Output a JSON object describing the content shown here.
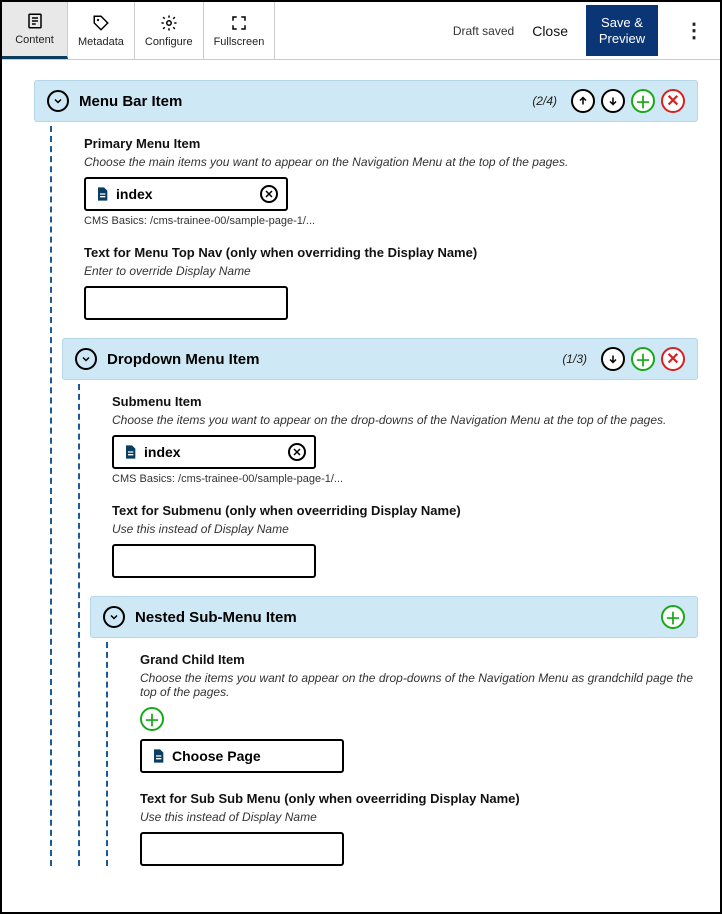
{
  "toolbar": {
    "tabs": {
      "content": "Content",
      "metadata": "Metadata",
      "configure": "Configure",
      "fullscreen": "Fullscreen"
    },
    "draft_saved": "Draft saved",
    "close": "Close",
    "save_preview_line1": "Save &",
    "save_preview_line2": "Preview"
  },
  "sections": {
    "menu_bar": {
      "title": "Menu Bar Item",
      "counter": "(2/4)",
      "fields": {
        "primary_label": "Primary Menu Item",
        "primary_help": "Choose the main items you want to appear on the Navigation Menu at the top of the pages.",
        "chip_text": "index",
        "path_text": "CMS Basics: /cms-trainee-00/sample-page-1/...",
        "override_label": "Text for Menu Top Nav (only when overriding the Display Name)",
        "override_help": "Enter to override Display Name",
        "override_value": ""
      }
    },
    "dropdown": {
      "title": "Dropdown Menu Item",
      "counter": "(1/3)",
      "fields": {
        "sub_label": "Submenu Item",
        "sub_help": "Choose the items you want to appear on the drop-downs of the Navigation Menu at the top of the pages.",
        "chip_text": "index",
        "path_text": "CMS Basics: /cms-trainee-00/sample-page-1/...",
        "override_label": "Text for Submenu (only when oveerriding Display Name)",
        "override_help": "Use this instead of Display Name",
        "override_value": ""
      }
    },
    "nested_sub": {
      "title": "Nested Sub-Menu Item",
      "fields": {
        "grand_label": "Grand Child Item",
        "grand_help": "Choose the items you want to appear on the drop-downs of the Navigation Menu as grandchild page the top of the pages.",
        "choose_page": "Choose Page",
        "override_label": "Text for Sub Sub Menu (only when oveerriding Display Name)",
        "override_help": "Use this instead of Display Name",
        "override_value": ""
      }
    }
  }
}
